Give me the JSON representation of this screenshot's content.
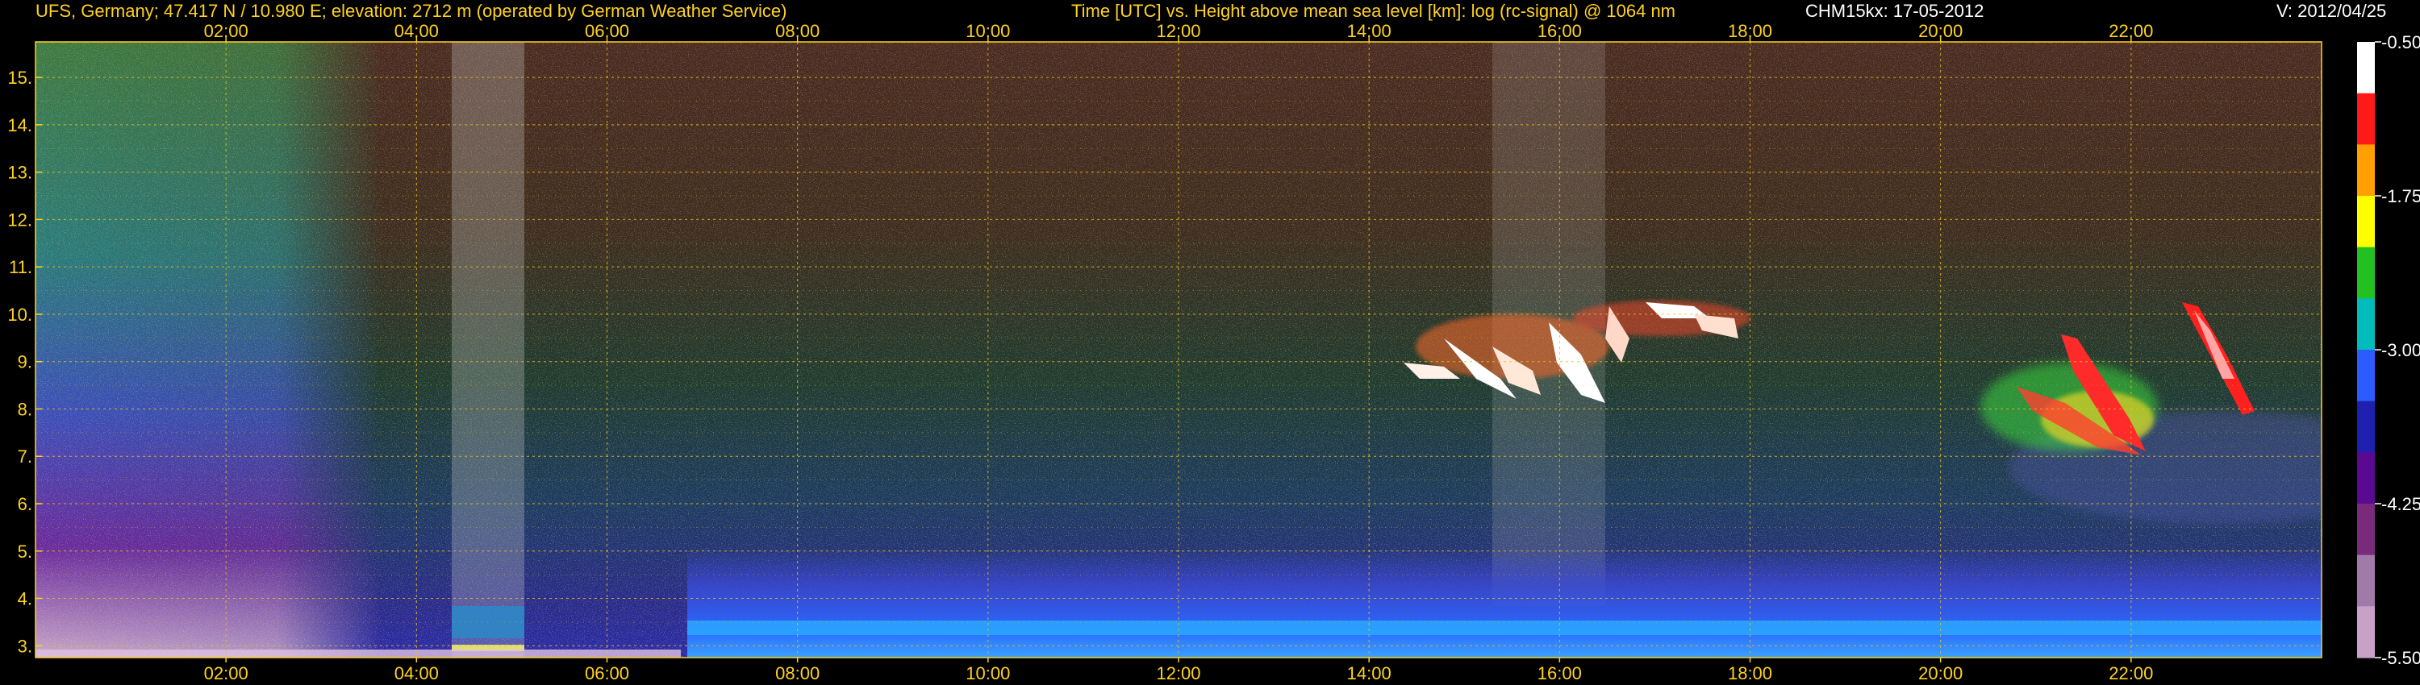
{
  "header": {
    "station": "UFS, Germany; 47.417 N / 10.980 E; elevation: 2712 m  (operated by German Weather Service)",
    "title": "Time [UTC] vs. Height above mean sea level [km]: log (rc-signal) @ 1064 nm",
    "instrument": "CHM15kx: 17-05-2012",
    "version": "V: 2012/04/25"
  },
  "chart_data": {
    "type": "heatmap",
    "title": "Time [UTC] vs. Height above mean sea level [km]: log (rc-signal) @ 1064 nm",
    "xlabel": "Time [UTC]",
    "ylabel": "Height above mean sea level [km]",
    "x_range": [
      0,
      24
    ],
    "y_range": [
      2.75,
      15.75
    ],
    "x_ticks": [
      "02:00",
      "04:00",
      "06:00",
      "08:00",
      "10:00",
      "12:00",
      "14:00",
      "16:00",
      "18:00",
      "20:00",
      "22:00"
    ],
    "y_ticks": [
      "3.",
      "4.",
      "5.",
      "6.",
      "7.",
      "8.",
      "9.",
      "10.",
      "11.",
      "12.",
      "13.",
      "14.",
      "15."
    ],
    "grid": true,
    "colorbar": {
      "range": [
        -5.5,
        -0.5
      ],
      "tick_labels": [
        "-0.50",
        "-1.75",
        "-3.00",
        "-4.25",
        "-5.50"
      ],
      "colors": [
        "#ffffff",
        "#ff1a1a",
        "#ffa000",
        "#ffff00",
        "#22c020",
        "#00bcbc",
        "#2a5cff",
        "#2020b0",
        "#5a0a90",
        "#7a2a7a",
        "#a07aa8",
        "#c8a0c8"
      ]
    },
    "features": [
      {
        "name": "boundary layer aerosol",
        "time": [
          6.8,
          23.9
        ],
        "height_km": [
          2.75,
          3.7
        ]
      },
      {
        "name": "low cloud",
        "time": [
          4.4,
          5.2
        ],
        "height_km": [
          3.0,
          3.8
        ]
      },
      {
        "name": "cirrus cloud",
        "time": [
          14.2,
          17.5
        ],
        "height_km": [
          8.0,
          10.5
        ]
      },
      {
        "name": "cirrus cloud",
        "time": [
          19.8,
          21.9
        ],
        "height_km": [
          7.0,
          9.6
        ]
      },
      {
        "name": "cirrus cloud",
        "time": [
          22.4,
          23.2
        ],
        "height_km": [
          8.0,
          10.3
        ]
      }
    ]
  }
}
